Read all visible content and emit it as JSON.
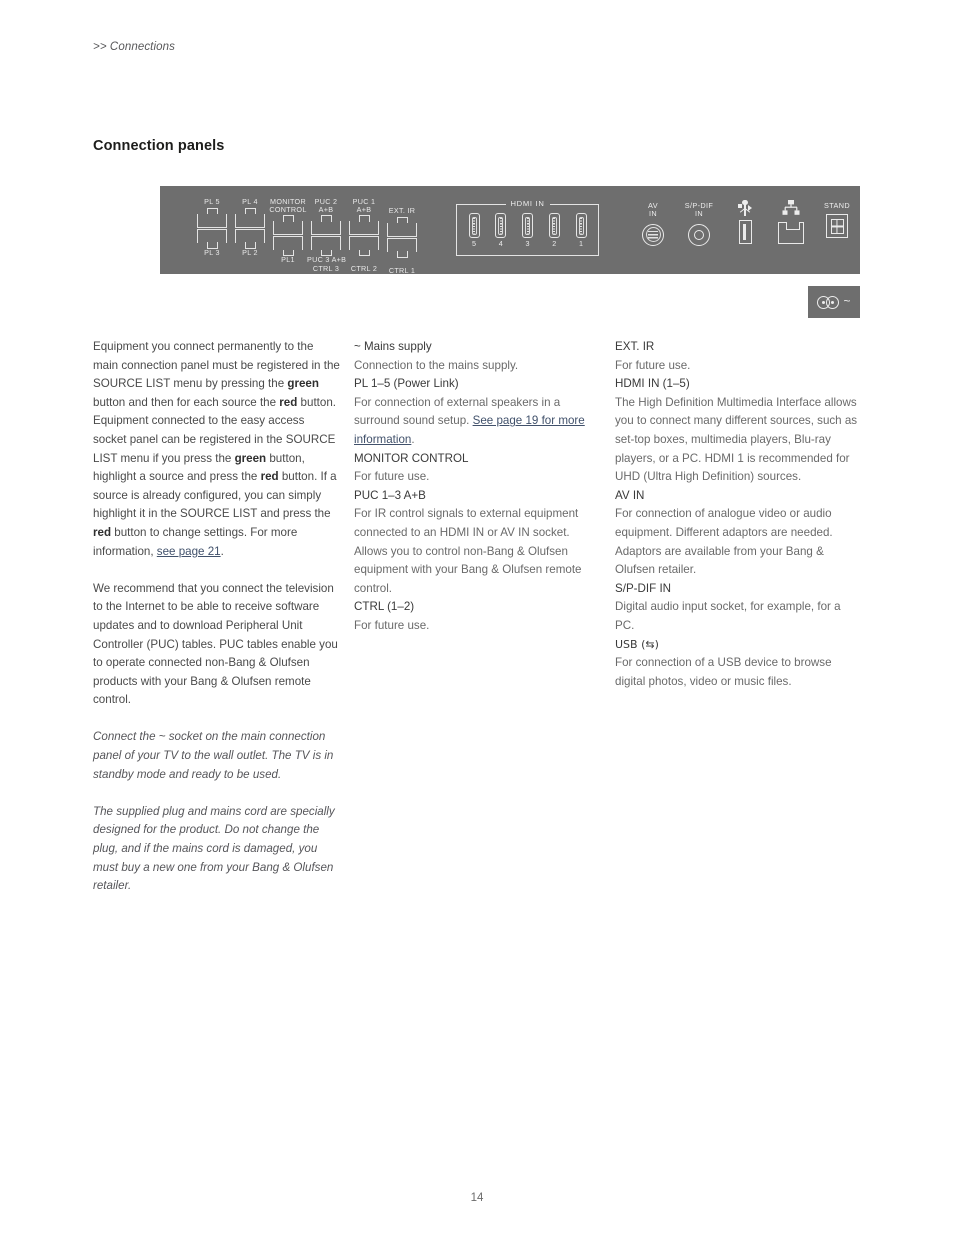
{
  "breadcrumb": ">> Connections",
  "page_title": "Connection panels",
  "page_number": "14",
  "colors": {
    "panel_background": "#6e6e6e",
    "panel_outline": "#e4e4e4",
    "link": "#41516b",
    "body_text": "#4a4a4a"
  },
  "panel": {
    "sockets_rj45": [
      {
        "top_label": "PL 5",
        "bottom_label": "PL 3"
      },
      {
        "top_label": "PL 4",
        "bottom_label": "PL 2"
      },
      {
        "top_label": "MONITOR CONTROL",
        "bottom_label": "PL1"
      },
      {
        "top_label": "PUC 2 A+B",
        "bottom_label": "PUC 3 A+B CTRL 3"
      },
      {
        "top_label": "PUC 1 A+B",
        "bottom_label": "CTRL 2"
      },
      {
        "top_label": "EXT. IR",
        "bottom_label": "CTRL 1"
      }
    ],
    "hdmi": {
      "group_label": "HDMI IN",
      "ports": [
        "5",
        "4",
        "3",
        "2",
        "1"
      ]
    },
    "icons": [
      {
        "label": "AV IN",
        "icon": "din-socket-icon"
      },
      {
        "label": "S/P-DIF IN",
        "icon": "coax-socket-icon"
      },
      {
        "label": "",
        "icon": "usb-icon"
      },
      {
        "label": "",
        "icon": "ethernet-icon"
      },
      {
        "label": "STAND",
        "icon": "stand-socket-icon"
      }
    ],
    "mini_panel": {
      "icon": "mains-socket-icon",
      "symbol": "~"
    }
  },
  "column1": {
    "paragraph1": {
      "s1": "Equipment you connect permanently to the main connection panel must be registered in the SOURCE LIST menu by pressing the ",
      "b1": "green",
      "s2": " button and then for each source the ",
      "b2": "red",
      "s3": " button. Equipment connected to the easy access socket panel can be registered in the SOURCE LIST menu if you press the ",
      "b3": "green",
      "s4": " button, highlight a source and press the ",
      "b4": "red",
      "s5": " button. If a source is already configured, you can simply highlight it in the SOURCE LIST and press the ",
      "b5": "red",
      "s6": " button to change settings. For more information, ",
      "link": "see page 21",
      "s7": "."
    },
    "paragraph2": "We recommend that you connect the television to the Internet to be able to receive software updates and to download Peripheral Unit Controller (PUC) tables. PUC tables enable you to operate connected non-Bang & Olufsen products with your Bang & Olufsen remote control.",
    "paragraph3": "Connect the ~ socket on the main connection panel of your TV to the wall outlet. The TV is in standby mode and ready to be used.",
    "paragraph4": "The supplied plug and mains cord are specially designed for the product. Do not change the plug, and if the mains cord is damaged, you must buy a new one from your Bang & Olufsen retailer."
  },
  "column2": {
    "sections": [
      {
        "heading": "~ Mains supply",
        "body": "Connection to the mains supply."
      },
      {
        "heading": "PL 1–5 (Power Link)",
        "body_pre": "For connection of external speakers in a surround sound setup. ",
        "link": "See page 19 for more information",
        "body_post": "."
      },
      {
        "heading": "MONITOR CONTROL",
        "body": "For future use."
      },
      {
        "heading": "PUC 1–3 A+B",
        "body": "For IR control signals to external equipment connected to an HDMI IN or AV IN socket. Allows you to control non-Bang & Olufsen equipment with your Bang & Olufsen remote control."
      },
      {
        "heading": "CTRL (1–2)",
        "body": "For future use."
      }
    ]
  },
  "column3": {
    "sections": [
      {
        "heading": "EXT. IR",
        "body": "For future use."
      },
      {
        "heading": "HDMI IN (1–5)",
        "body": "The High Definition Multimedia Interface allows you to connect many different sources, such as set-top boxes, multimedia players, Blu-ray players, or a PC. HDMI 1 is recommended for UHD (Ultra High Definition) sources."
      },
      {
        "heading": "AV IN",
        "body": "For connection of analogue video or audio equipment. Different adaptors are needed. Adaptors are available from your Bang & Olufsen retailer."
      },
      {
        "heading": "S/P-DIF IN",
        "body": "Digital audio input socket, for example, for a PC."
      },
      {
        "heading": "USB (⇆)",
        "body": "For connection of a USB device to browse digital photos, video or music files."
      }
    ]
  }
}
